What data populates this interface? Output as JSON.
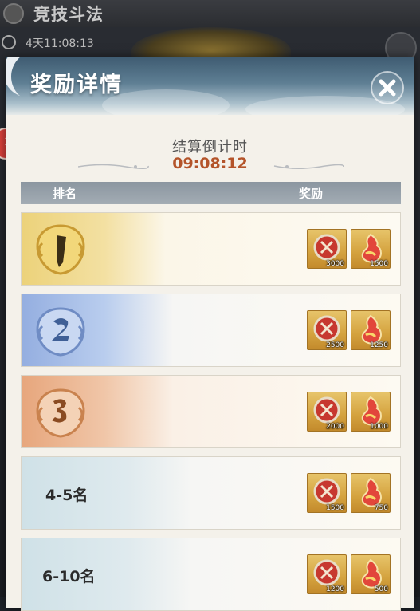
{
  "background": {
    "title": "竞技斗法",
    "timer": "4天11:08:13"
  },
  "dialog": {
    "title": "奖励详情",
    "countdown_label": "结算倒计时",
    "countdown_value": "09:08:12",
    "table": {
      "rank_header": "排名",
      "reward_header": "奖励"
    },
    "rows": [
      {
        "rank": "1",
        "rank_text": "",
        "style": "gold",
        "rewards": [
          {
            "icon": "red-medallion-icon",
            "count": "3000"
          },
          {
            "icon": "red-gourd-icon",
            "count": "1500"
          }
        ]
      },
      {
        "rank": "2",
        "rank_text": "",
        "style": "blue",
        "rewards": [
          {
            "icon": "red-medallion-icon",
            "count": "2500"
          },
          {
            "icon": "red-gourd-icon",
            "count": "1250"
          }
        ]
      },
      {
        "rank": "3",
        "rank_text": "",
        "style": "orange",
        "rewards": [
          {
            "icon": "red-medallion-icon",
            "count": "2000"
          },
          {
            "icon": "red-gourd-icon",
            "count": "1000"
          }
        ]
      },
      {
        "rank": "4-5",
        "rank_text": "4-5名",
        "style": "pale",
        "rewards": [
          {
            "icon": "red-medallion-icon",
            "count": "1500"
          },
          {
            "icon": "red-gourd-icon",
            "count": "750"
          }
        ]
      },
      {
        "rank": "6-10",
        "rank_text": "6-10名",
        "style": "pale",
        "rewards": [
          {
            "icon": "red-medallion-icon",
            "count": "1200"
          },
          {
            "icon": "red-gourd-icon",
            "count": "500"
          }
        ]
      }
    ]
  },
  "colors": {
    "countdown": "#b4542a",
    "header_bar": "#9aa4ad",
    "slot_gold": "#d4a23e"
  }
}
